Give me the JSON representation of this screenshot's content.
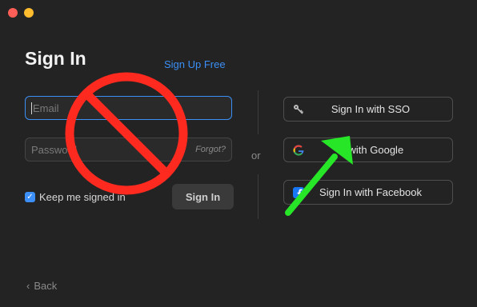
{
  "window": {
    "controls": [
      "close",
      "minimize"
    ]
  },
  "header": {
    "title": "Sign In",
    "signup_link": "Sign Up Free"
  },
  "form": {
    "email_placeholder": "Email",
    "password_placeholder": "Password",
    "forgot_link": "Forgot?",
    "keep_signed_in_label": "Keep me signed in",
    "keep_signed_in_checked": true,
    "signin_button": "Sign In"
  },
  "separator": {
    "label": "or"
  },
  "alt_signin": [
    {
      "label": "Sign In with SSO",
      "icon": "key-icon"
    },
    {
      "label": "in with Google",
      "icon": "google-icon"
    },
    {
      "label": "Sign In with Facebook",
      "icon": "facebook-icon"
    }
  ],
  "footer": {
    "back_label": "Back"
  },
  "colors": {
    "background": "#232323",
    "accent": "#3b8ff6",
    "prohibit_red": "#ff2a1f",
    "arrow_green": "#27e627"
  },
  "annotations": {
    "prohibit_symbol": "no-entry-icon",
    "pointer": "green-arrow-icon"
  }
}
